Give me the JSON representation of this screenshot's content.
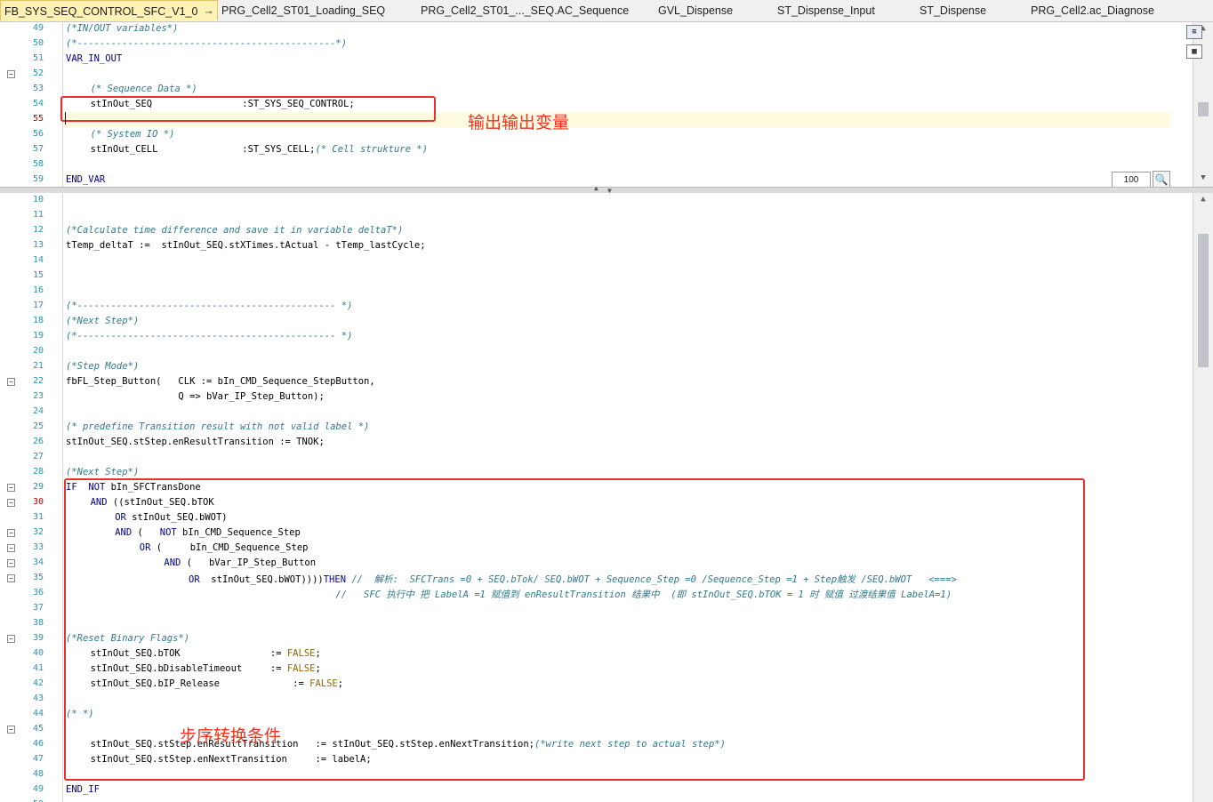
{
  "tabs": [
    {
      "label": "FB_SYS_SEQ_CONTROL_SFC_V1_0",
      "active": true
    },
    {
      "label": "PRG_Cell2_ST01_Loading_SEQ"
    },
    {
      "label": "PRG_Cell2_ST01_..._SEQ.AC_Sequence"
    },
    {
      "label": "GVL_Dispense"
    },
    {
      "label": "ST_Dispense_Input"
    },
    {
      "label": "ST_Dispense"
    },
    {
      "label": "PRG_Cell2.ac_Diagnose"
    }
  ],
  "tab_icons": {
    "pin": "pin-icon",
    "close": "close-icon"
  },
  "declaration": {
    "lines": [
      {
        "n": "49",
        "segs": [
          {
            "t": "(*IN/OUT variables*)",
            "c": "cm"
          }
        ],
        "ind": 0
      },
      {
        "n": "50",
        "segs": [
          {
            "t": "(*----------------------------------------------*)",
            "c": "cm"
          }
        ],
        "ind": 0
      },
      {
        "n": "51",
        "segs": [
          {
            "t": "VAR_IN_OUT",
            "c": "kw"
          }
        ],
        "ind": 0
      },
      {
        "n": "52",
        "segs": [],
        "ind": 0,
        "fold": true
      },
      {
        "n": "53",
        "segs": [
          {
            "t": "(* Sequence Data *)",
            "c": "cm"
          }
        ],
        "ind": 4
      },
      {
        "n": "54",
        "segs": [
          {
            "t": "stInOut_SEQ                :ST_SYS_SEQ_CONTROL;"
          }
        ],
        "ind": 4
      },
      {
        "n": "55",
        "segs": [],
        "ind": 0,
        "cur": true
      },
      {
        "n": "56",
        "segs": [
          {
            "t": "(* System IO *)",
            "c": "cm"
          }
        ],
        "ind": 4
      },
      {
        "n": "57",
        "segs": [
          {
            "t": "stInOut_CELL               :ST_SYS_CELL;"
          },
          {
            "t": "(* Cell strukture *)",
            "c": "cm"
          }
        ],
        "ind": 4
      },
      {
        "n": "58",
        "segs": [],
        "ind": 0
      },
      {
        "n": "59",
        "segs": [
          {
            "t": "END_VAR",
            "c": "kw"
          }
        ],
        "ind": 0
      }
    ],
    "zoom": "100",
    "annotation": "输出输出变量"
  },
  "implementation": {
    "lines": [
      {
        "n": "10",
        "segs": [],
        "ind": 0
      },
      {
        "n": "11",
        "segs": [],
        "ind": 0
      },
      {
        "n": "12",
        "segs": [
          {
            "t": "(*Calculate time difference and save it in variable deltaT*)",
            "c": "cm"
          }
        ],
        "ind": 0
      },
      {
        "n": "13",
        "segs": [
          {
            "t": "tTemp_deltaT :=  stInOut_SEQ.stXTimes.tActual - tTemp_lastCycle;"
          }
        ],
        "ind": 0
      },
      {
        "n": "14",
        "segs": [],
        "ind": 0
      },
      {
        "n": "15",
        "segs": [],
        "ind": 0
      },
      {
        "n": "16",
        "segs": [],
        "ind": 0
      },
      {
        "n": "17",
        "segs": [
          {
            "t": "(*---------------------------------------------- *)",
            "c": "cm"
          }
        ],
        "ind": 0
      },
      {
        "n": "18",
        "segs": [
          {
            "t": "(*Next Step*)",
            "c": "cm"
          }
        ],
        "ind": 0
      },
      {
        "n": "19",
        "segs": [
          {
            "t": "(*---------------------------------------------- *)",
            "c": "cm"
          }
        ],
        "ind": 0
      },
      {
        "n": "20",
        "segs": [],
        "ind": 0
      },
      {
        "n": "21",
        "segs": [
          {
            "t": "(*Step Mode*)",
            "c": "cm"
          }
        ],
        "ind": 0
      },
      {
        "n": "22",
        "segs": [
          {
            "t": "fbFL_Step_Button(   CLK := bIn_CMD_Sequence_StepButton,"
          }
        ],
        "ind": 0,
        "fold": true
      },
      {
        "n": "23",
        "segs": [
          {
            "t": "                    Q => bVar_IP_Step_Button);"
          }
        ],
        "ind": 0
      },
      {
        "n": "24",
        "segs": [],
        "ind": 0
      },
      {
        "n": "25",
        "segs": [
          {
            "t": "(* predefine Transition result with not valid label *)",
            "c": "cm"
          }
        ],
        "ind": 0
      },
      {
        "n": "26",
        "segs": [
          {
            "t": "stInOut_SEQ.stStep.enResultTransition := TNOK;"
          }
        ],
        "ind": 0
      },
      {
        "n": "27",
        "segs": [],
        "ind": 0
      },
      {
        "n": "28",
        "segs": [
          {
            "t": "(*Next Step*)",
            "c": "cm"
          }
        ],
        "ind": 0
      },
      {
        "n": "29",
        "segs": [
          {
            "t": "IF",
            "c": "kw"
          },
          {
            "t": "  "
          },
          {
            "t": "NOT",
            "c": "kw"
          },
          {
            "t": " bIn_SFCTransDone"
          }
        ],
        "ind": 0,
        "fold": true
      },
      {
        "n": "30",
        "segs": [
          {
            "t": "AND",
            "c": "kw"
          },
          {
            "t": " ((stInOut_SEQ.bTOK"
          }
        ],
        "ind": 4,
        "fold": true,
        "cur": true
      },
      {
        "n": "31",
        "segs": [
          {
            "t": "OR",
            "c": "kw"
          },
          {
            "t": " stInOut_SEQ.bWOT)"
          }
        ],
        "ind": 8
      },
      {
        "n": "32",
        "segs": [
          {
            "t": "AND",
            "c": "kw"
          },
          {
            "t": " (   "
          },
          {
            "t": "NOT",
            "c": "kw"
          },
          {
            "t": " bIn_CMD_Sequence_Step"
          }
        ],
        "ind": 8,
        "fold": true
      },
      {
        "n": "33",
        "segs": [
          {
            "t": "OR",
            "c": "kw"
          },
          {
            "t": " (     bIn_CMD_Sequence_Step"
          }
        ],
        "ind": 12,
        "fold": true
      },
      {
        "n": "34",
        "segs": [
          {
            "t": "AND",
            "c": "kw"
          },
          {
            "t": " (   bVar_IP_Step_Button"
          }
        ],
        "ind": 16,
        "fold": true
      },
      {
        "n": "35",
        "segs": [
          {
            "t": "OR",
            "c": "kw"
          },
          {
            "t": "  stInOut_SEQ.bWOT))))"
          },
          {
            "t": "THEN",
            "c": "kw"
          },
          {
            "t": " //  解析:  SFCTrans =0 + SEQ.bTok/ SEQ.bWOT + Sequence_Step =0 /Sequence_Step =1 + Step触发 /SEQ.bWOT   <===>",
            "c": "cm"
          }
        ],
        "ind": 20,
        "fold": true
      },
      {
        "n": "36",
        "segs": [
          {
            "t": "                                                //   SFC 执行中 把 LabelA =1 赋值到 enResultTransition 结果中  (即 stInOut_SEQ.bTOK = 1 时 赋值 过渡结果值 LabelA=1)",
            "c": "cm"
          }
        ],
        "ind": 0
      },
      {
        "n": "37",
        "segs": [],
        "ind": 0
      },
      {
        "n": "38",
        "segs": [],
        "ind": 0
      },
      {
        "n": "39",
        "segs": [
          {
            "t": "(*Reset Binary Flags*)",
            "c": "cm"
          }
        ],
        "ind": 0,
        "fold": true
      },
      {
        "n": "40",
        "segs": [
          {
            "t": "stInOut_SEQ.bTOK                := "
          },
          {
            "t": "FALSE",
            "c": "lit"
          },
          {
            "t": ";"
          }
        ],
        "ind": 4
      },
      {
        "n": "41",
        "segs": [
          {
            "t": "stInOut_SEQ.bDisableTimeout     := "
          },
          {
            "t": "FALSE",
            "c": "lit"
          },
          {
            "t": ";"
          }
        ],
        "ind": 4
      },
      {
        "n": "42",
        "segs": [
          {
            "t": "stInOut_SEQ.bIP_Release             := "
          },
          {
            "t": "FALSE",
            "c": "lit"
          },
          {
            "t": ";"
          }
        ],
        "ind": 4
      },
      {
        "n": "43",
        "segs": [],
        "ind": 0
      },
      {
        "n": "44",
        "segs": [
          {
            "t": "(* *)",
            "c": "cm"
          }
        ],
        "ind": 0
      },
      {
        "n": "45",
        "segs": [],
        "ind": 0,
        "fold": true
      },
      {
        "n": "46",
        "segs": [
          {
            "t": "stInOut_SEQ.stStep.enResultTransition   := stInOut_SEQ.stStep.enNextTransition;"
          },
          {
            "t": "(*write next step to actual step*)",
            "c": "cm"
          }
        ],
        "ind": 4
      },
      {
        "n": "47",
        "segs": [
          {
            "t": "stInOut_SEQ.stStep.enNextTransition     := labelA;"
          }
        ],
        "ind": 4
      },
      {
        "n": "48",
        "segs": [],
        "ind": 0
      },
      {
        "n": "49",
        "segs": [
          {
            "t": "END_IF",
            "c": "kw"
          }
        ],
        "ind": 0
      },
      {
        "n": "50",
        "segs": [],
        "ind": 0
      }
    ],
    "annotation": "步序转换条件"
  },
  "colors": {
    "annotation": "#e8312f",
    "active_tab": "#fff2b3",
    "current_line": "#fffbe0"
  }
}
